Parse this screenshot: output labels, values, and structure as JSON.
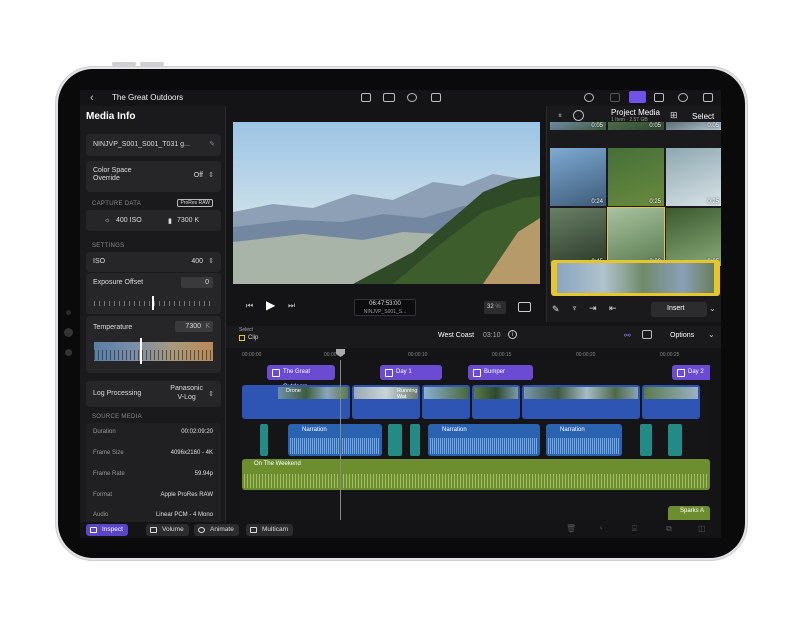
{
  "app": {
    "project_title": "The Great Outdoors"
  },
  "media_info": {
    "title": "Media Info",
    "clip_name": "NINJVP_S001_S001_T031 g...",
    "color_space_label": "Color Space\nOverride",
    "color_space_value": "Off",
    "capture_data_label": "CAPTURE DATA",
    "capture_badge": "ProRes RAW",
    "iso_capture": "400 ISO",
    "kelvin_capture": "7300 K",
    "settings_label": "SETTINGS",
    "iso_label": "ISO",
    "iso_value": "400",
    "exposure_label": "Exposure Offset",
    "exposure_value": "0",
    "temperature_label": "Temperature",
    "temperature_value": "7300",
    "temperature_unit": "K",
    "log_label": "Log Processing",
    "log_value": "Panasonic\nV-Log",
    "source_media_label": "SOURCE MEDIA",
    "rows": [
      {
        "label": "Duration",
        "value": "00:02:09:20"
      },
      {
        "label": "Frame Size",
        "value": "4096x2160 - 4K"
      },
      {
        "label": "Frame Rate",
        "value": "59.94p"
      },
      {
        "label": "Format",
        "value": "Apple ProRes RAW"
      },
      {
        "label": "Audio",
        "value": "Linear PCM - 4 Mono"
      }
    ]
  },
  "viewer": {
    "timecode": "06:47:53:00",
    "clip_name": "NINJVP_S001_S...",
    "zoom": "32",
    "zoom_unit": "%"
  },
  "browser": {
    "title": "Project Media",
    "subtitle": "1 Item · 2.57 GB",
    "select_label": "Select",
    "insert_label": "Insert",
    "thumbs": [
      {
        "dur": "0:05",
        "colors": [
          "#6d8aa6",
          "#3e5b3e"
        ]
      },
      {
        "dur": "0:05",
        "colors": [
          "#4f6a4a",
          "#2d4a2f"
        ]
      },
      {
        "dur": "0:05",
        "colors": [
          "#5a6f7a",
          "#b5c6cf"
        ]
      },
      {
        "dur": "0:24",
        "colors": [
          "#7eaad2",
          "#3e5b7a"
        ]
      },
      {
        "dur": "0:25",
        "colors": [
          "#456f3a",
          "#6a8a3e"
        ]
      },
      {
        "dur": "0:25",
        "colors": [
          "#8ea8b0",
          "#d8e2e6"
        ]
      },
      {
        "dur": "0:45",
        "colors": [
          "#6a7f66",
          "#2a3a28"
        ]
      },
      {
        "dur": "2:09",
        "colors": [
          "#a7c3a0",
          "#5a7a4e"
        ]
      },
      {
        "dur": "0:05",
        "colors": [
          "#3a5a2e",
          "#8aaa7a"
        ]
      }
    ]
  },
  "timeline": {
    "select_label": "Select",
    "clip_label": "Clip",
    "project_name": "West Coast",
    "duration": "03:10",
    "options_label": "Options",
    "ruler": [
      "00:00:00",
      "00:00:05",
      "00:00:10",
      "00:00:15",
      "00:00:20",
      "00:00:25"
    ],
    "titles": [
      "The Great Outdoors",
      "Day 1",
      "Bumper",
      "Day 2"
    ],
    "video_clips": [
      "Drone",
      "Running Wat"
    ],
    "narration_label": "Narration",
    "music_label": "On The Weekend",
    "sfx_label": "Sparks A"
  },
  "bottom": {
    "inspect": "Inspect",
    "volume": "Volume",
    "animate": "Animate",
    "multicam": "Multicam"
  }
}
